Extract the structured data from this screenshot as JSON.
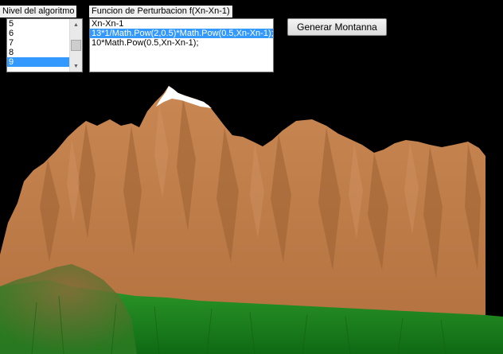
{
  "level_group": {
    "title": "Nivel del algoritmo",
    "items": [
      "5",
      "6",
      "7",
      "8",
      "9"
    ],
    "selected": "9"
  },
  "perturbation_group": {
    "title": "Funcion de Perturbacion f(Xn-Xn-1)",
    "items": [
      "Xn-Xn-1",
      "13*1/Math.Pow(2,0.5)*Math.Pow(0.5,Xn-Xn-1);",
      "10*Math.Pow(0.5,Xn-Xn-1);"
    ],
    "selected": "13*1/Math.Pow(2,0.5)*Math.Pow(0.5,Xn-Xn-1);"
  },
  "generate_button": {
    "label": "Generar Montanna"
  },
  "colors": {
    "background": "#000000",
    "mountain": "#c1804e",
    "mountain_shadow": "#a5683b",
    "snow": "#ffffff",
    "grass": "#1f8a1f",
    "selection": "#3399ff"
  }
}
